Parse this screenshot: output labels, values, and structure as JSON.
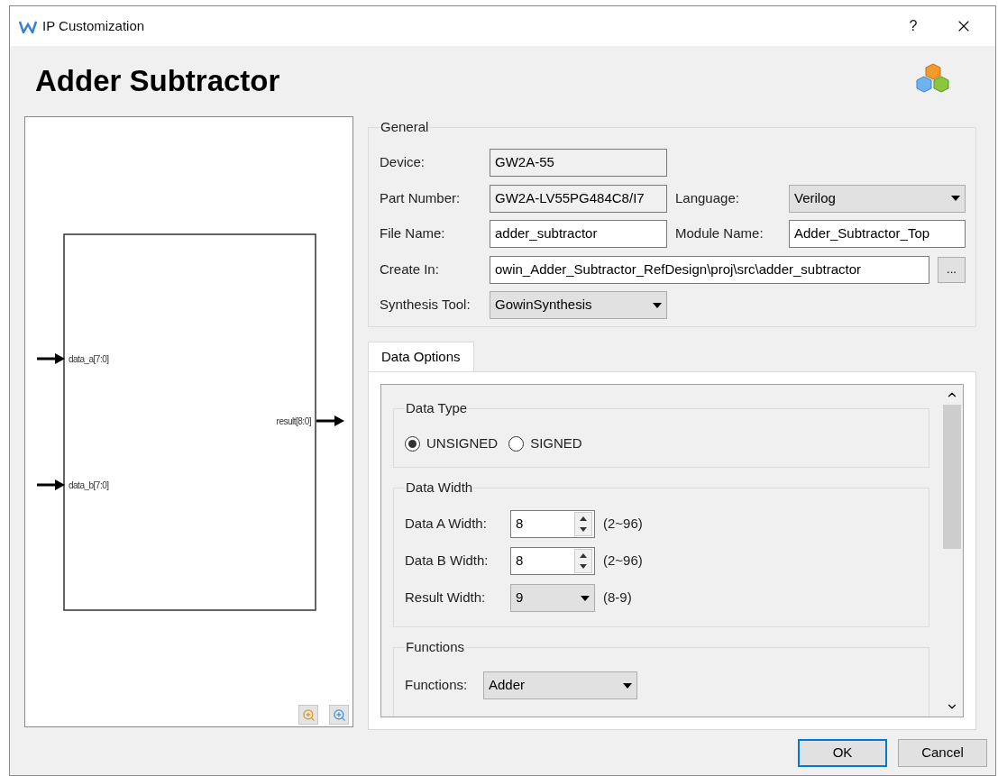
{
  "window": {
    "title": "IP Customization",
    "help": "?"
  },
  "header": {
    "title": "Adder Subtractor"
  },
  "diagram": {
    "ports": [
      {
        "label": "data_a[7:0]",
        "kind": "input"
      },
      {
        "label": "data_b[7:0]",
        "kind": "input"
      },
      {
        "label": "result[8:0]",
        "kind": "output"
      }
    ]
  },
  "general": {
    "title": "General",
    "device": {
      "label": "Device:",
      "value": "GW2A-55"
    },
    "part_number": {
      "label": "Part Number:",
      "value": "GW2A-LV55PG484C8/I7"
    },
    "language": {
      "label": "Language:",
      "value": "Verilog"
    },
    "file_name": {
      "label": "File Name:",
      "value": "adder_subtractor"
    },
    "module_name": {
      "label": "Module Name:",
      "value": "Adder_Subtractor_Top"
    },
    "create_in": {
      "label": "Create In:",
      "value": "owin_Adder_Subtractor_RefDesign\\proj\\src\\adder_subtractor",
      "browse": "..."
    },
    "synthesis_tool": {
      "label": "Synthesis Tool:",
      "value": "GowinSynthesis"
    }
  },
  "tabs": [
    {
      "label": "Data Options",
      "selected": true
    }
  ],
  "data_type": {
    "title": "Data Type",
    "options": [
      {
        "label": "UNSIGNED",
        "selected": true
      },
      {
        "label": "SIGNED",
        "selected": false
      }
    ]
  },
  "data_width": {
    "title": "Data Width",
    "rows": [
      {
        "kind": "spinner",
        "label": "Data A Width:",
        "value": "8",
        "range": "(2~96)"
      },
      {
        "kind": "spinner",
        "label": "Data B Width:",
        "value": "8",
        "range": "(2~96)"
      },
      {
        "kind": "dropdown",
        "label": "Result Width:",
        "value": "9",
        "range": "(8-9)"
      }
    ]
  },
  "functions": {
    "title": "Functions",
    "label": "Functions:",
    "value": "Adder"
  },
  "buttons": [
    {
      "label": "OK",
      "default": true
    },
    {
      "label": "Cancel",
      "default": false
    }
  ]
}
